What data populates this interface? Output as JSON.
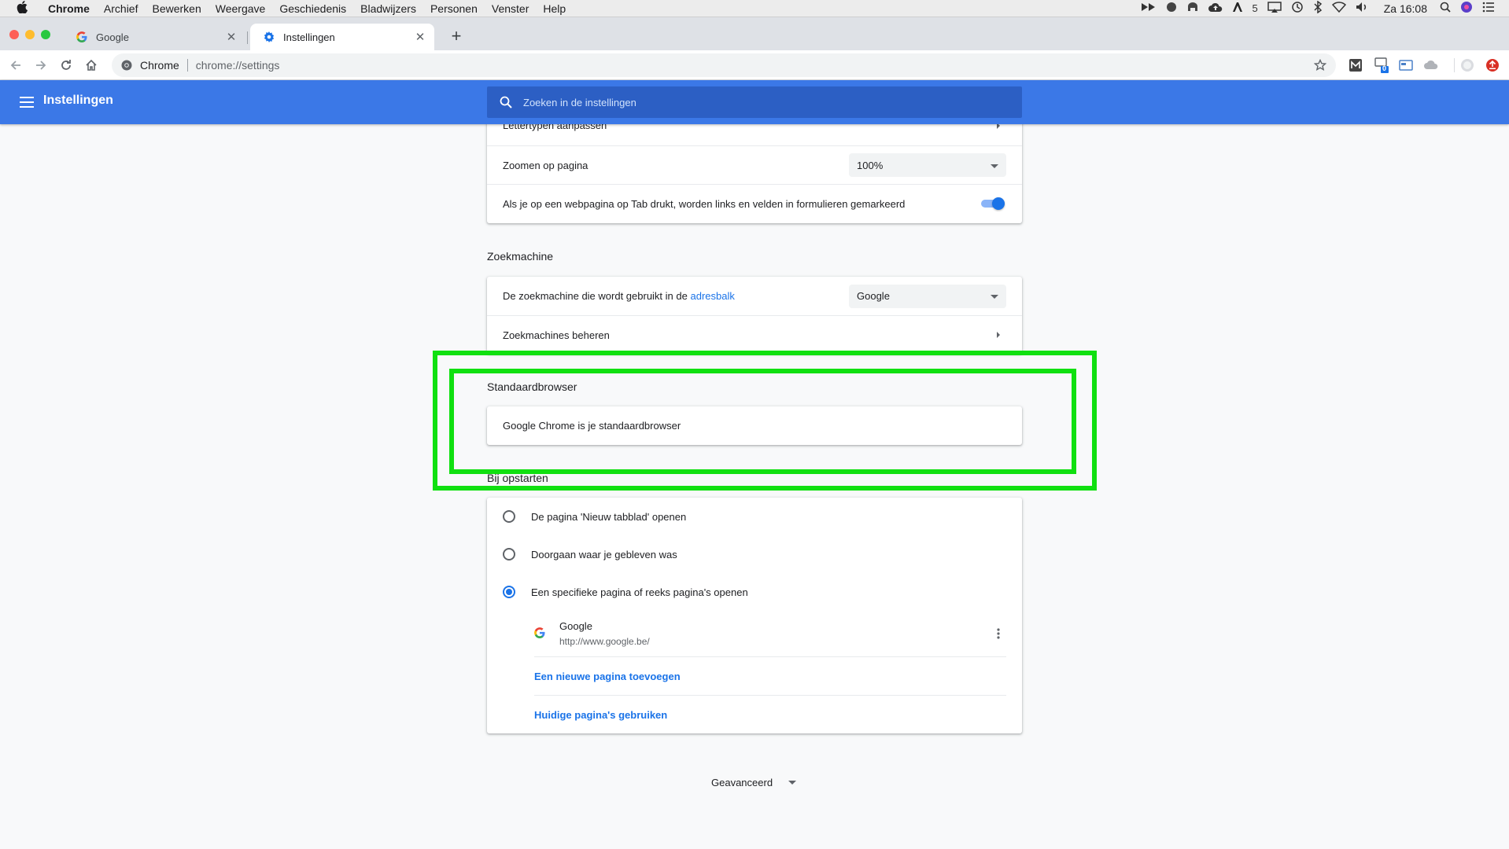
{
  "menubar": {
    "app": "Chrome",
    "items": [
      "Archief",
      "Bewerken",
      "Weergave",
      "Geschiedenis",
      "Bladwijzers",
      "Personen",
      "Venster",
      "Help"
    ],
    "tray_count": "5",
    "clock": "Za 16:08"
  },
  "tabs": [
    {
      "title": "Google",
      "icon": "google-g-icon",
      "active": false
    },
    {
      "title": "Instellingen",
      "icon": "settings-gear-icon",
      "active": true
    }
  ],
  "omnibox": {
    "site": "Chrome",
    "url": "chrome://settings"
  },
  "extensions": {
    "badge": "0"
  },
  "header": {
    "title": "Instellingen",
    "search_placeholder": "Zoeken in de instellingen"
  },
  "appearance": {
    "fonts_label": "Lettertypen aanpassen",
    "zoom_label": "Zoomen op pagina",
    "zoom_value": "100%",
    "tab_highlight_label": "Als je op een webpagina op Tab drukt, worden links en velden in formulieren gemarkeerd",
    "tab_highlight_on": true
  },
  "search_engine": {
    "section_title": "Zoekmachine",
    "engine_label": "De zoekmachine die wordt gebruikt in de",
    "engine_link": "adresbalk",
    "engine_value": "Google",
    "manage_label": "Zoekmachines beheren"
  },
  "default_browser": {
    "section_title": "Standaardbrowser",
    "status": "Google Chrome is je standaardbrowser"
  },
  "startup": {
    "section_title": "Bij opstarten",
    "options": [
      {
        "label": "De pagina 'Nieuw tabblad' openen",
        "checked": false
      },
      {
        "label": "Doorgaan waar je gebleven was",
        "checked": false
      },
      {
        "label": "Een specifieke pagina of reeks pagina's openen",
        "checked": true
      }
    ],
    "pages": [
      {
        "name": "Google",
        "url": "http://www.google.be/"
      }
    ],
    "add_page": "Een nieuwe pagina toevoegen",
    "use_current": "Huidige pagina's gebruiken"
  },
  "advanced_label": "Geavanceerd",
  "colors": {
    "header": "#3b78e7",
    "accent": "#1a73e8",
    "highlight": "#10e010"
  }
}
